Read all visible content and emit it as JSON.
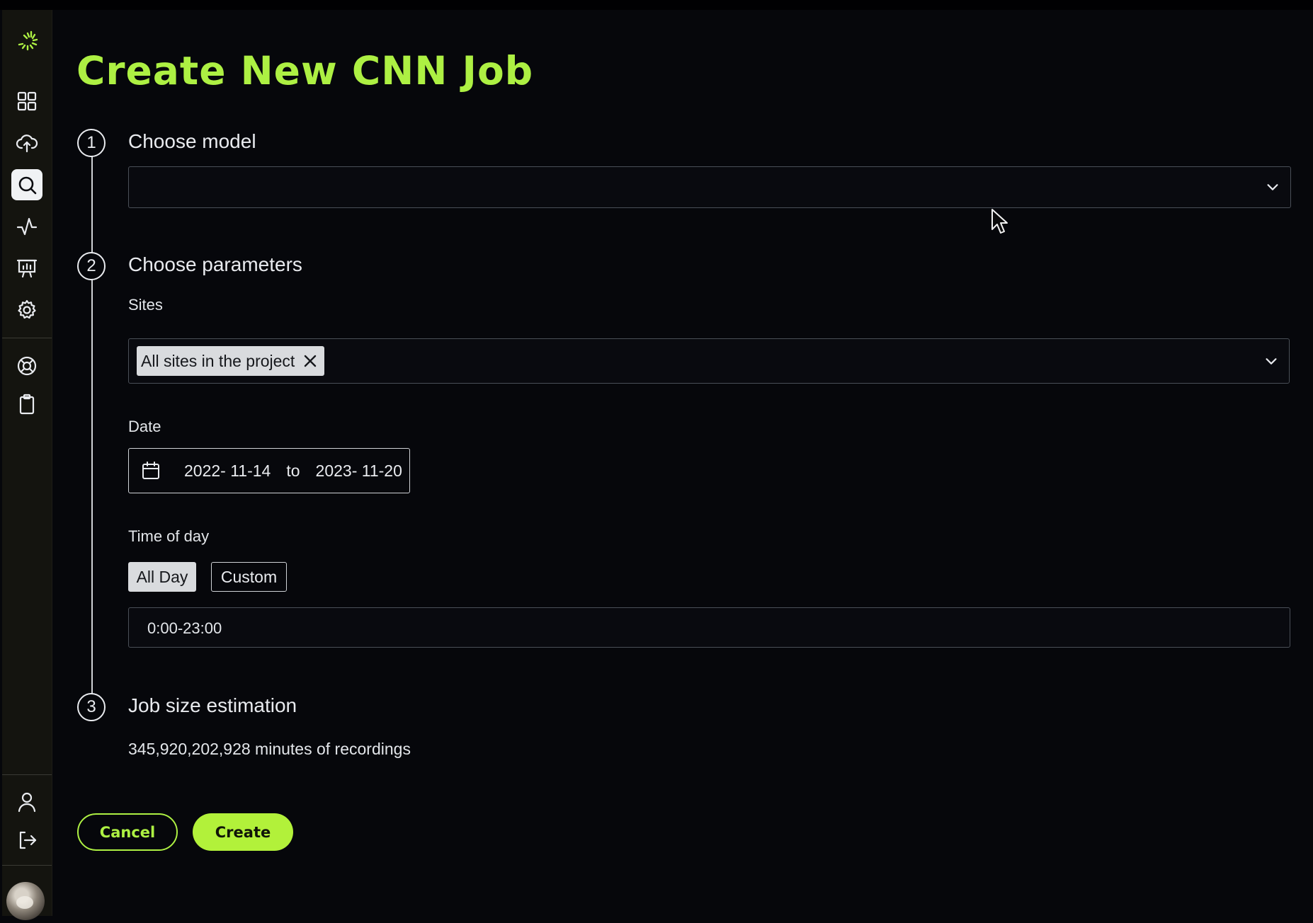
{
  "page": {
    "title": "Create New CNN Job",
    "accent_color": "#adf043"
  },
  "sidebar": {
    "items": [
      {
        "name": "logo-icon"
      },
      {
        "name": "dashboard-grid-icon"
      },
      {
        "name": "cloud-upload-icon"
      },
      {
        "name": "search-icon",
        "active": true
      },
      {
        "name": "activity-pulse-icon"
      },
      {
        "name": "presentation-chart-icon"
      },
      {
        "name": "gear-icon"
      },
      {
        "name": "lifebuoy-icon"
      },
      {
        "name": "clipboard-icon"
      },
      {
        "name": "user-icon"
      },
      {
        "name": "logout-icon"
      },
      {
        "name": "avatar"
      }
    ]
  },
  "steps": {
    "one": {
      "number": "1",
      "title": "Choose model",
      "model_value": ""
    },
    "two": {
      "number": "2",
      "title": "Choose parameters",
      "sites_label": "Sites",
      "sites_chip": "All sites in the project",
      "date_label": "Date",
      "date_from": "2022- 11-14",
      "date_to_word": "to",
      "date_to": "2023- 11-20",
      "time_label": "Time of day",
      "time_options": [
        "All Day",
        "Custom"
      ],
      "time_selected": "All Day",
      "time_value": "0:00-23:00"
    },
    "three": {
      "number": "3",
      "title": "Job size estimation",
      "estimate": "345,920,202,928 minutes of recordings"
    }
  },
  "actions": {
    "cancel": "Cancel",
    "create": "Create"
  }
}
